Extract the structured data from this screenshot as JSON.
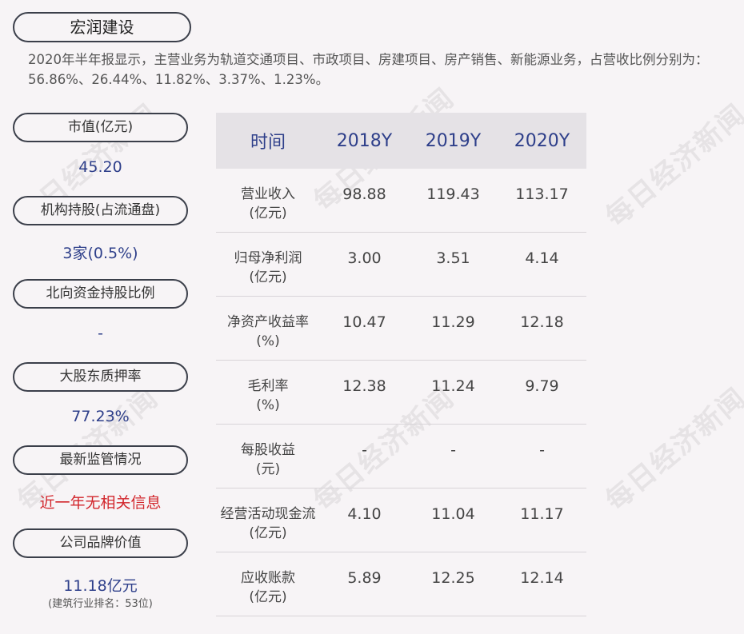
{
  "company_name": "宏润建设",
  "summary": "2020年半年报显示，主营业务为轨道交通项目、市政项目、房建项目、房产销售、新能源业务，占营收比例分别为：56.86%、26.44%、11.82%、3.37%、1.23%。",
  "watermark": "每日经济新闻",
  "metrics": [
    {
      "label": "市值(亿元)",
      "value": "45.20"
    },
    {
      "label": "机构持股(占流通盘)",
      "value": "3家(0.5%)"
    },
    {
      "label": "北向资金持股比例",
      "value": "-"
    },
    {
      "label": "大股东质押率",
      "value": "77.23%"
    },
    {
      "label": "最新监管情况",
      "value": "近一年无相关信息"
    },
    {
      "label": "公司品牌价值",
      "value": "11.18亿元",
      "sub": "(建筑行业排名：53位)"
    }
  ],
  "table": {
    "headers": [
      "时间",
      "2018Y",
      "2019Y",
      "2020Y"
    ],
    "rows": [
      {
        "name": "营业收入",
        "unit": "(亿元)",
        "values": [
          "98.88",
          "119.43",
          "113.17"
        ]
      },
      {
        "name": "归母净利润",
        "unit": "(亿元)",
        "values": [
          "3.00",
          "3.51",
          "4.14"
        ]
      },
      {
        "name": "净资产收益率",
        "unit": "(%)",
        "values": [
          "10.47",
          "11.29",
          "12.18"
        ]
      },
      {
        "name": "毛利率",
        "unit": "(%)",
        "values": [
          "12.38",
          "11.24",
          "9.79"
        ]
      },
      {
        "name": "每股收益",
        "unit": "(元)",
        "values": [
          "-",
          "-",
          "-"
        ]
      },
      {
        "name": "经营活动现金流",
        "unit": "(亿元)",
        "values": [
          "4.10",
          "11.04",
          "11.17"
        ]
      },
      {
        "name": "应收账款",
        "unit": "(亿元)",
        "values": [
          "5.89",
          "12.25",
          "12.14"
        ]
      }
    ]
  },
  "colors": {
    "accent_blue": "#2e3f8a",
    "alert_red": "#d2262c",
    "background": "#f7f4f6",
    "header_bg": "#e5e2e6"
  }
}
